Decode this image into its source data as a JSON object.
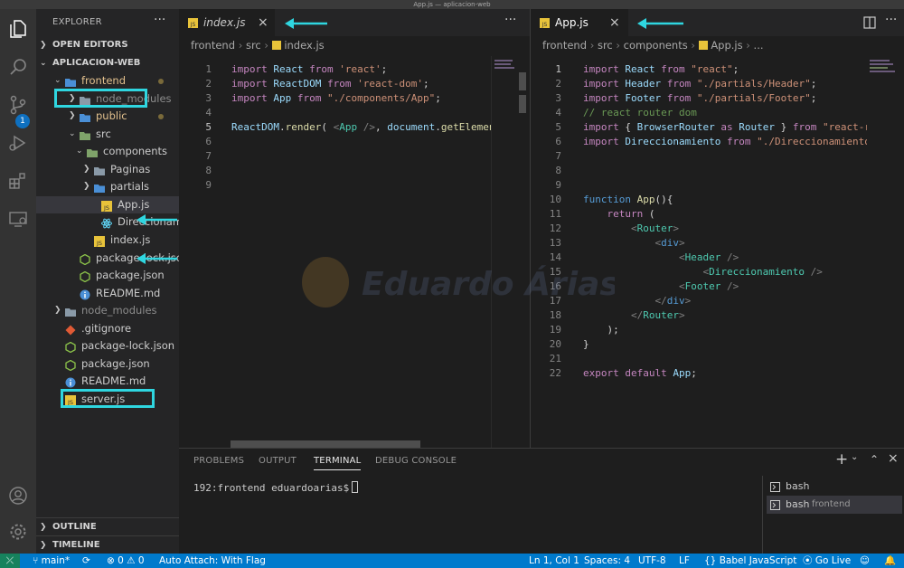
{
  "window": {
    "title": "App.js — aplicacion-web"
  },
  "sidebar": {
    "title": "EXPLORER",
    "more": "···",
    "sections": {
      "open_editors": "OPEN EDITORS",
      "project": "APLICACION-WEB",
      "outline": "OUTLINE",
      "timeline": "TIMELINE"
    },
    "tree": [
      {
        "label": "frontend"
      },
      {
        "label": "node_modules"
      },
      {
        "label": "public"
      },
      {
        "label": "src"
      },
      {
        "label": "components"
      },
      {
        "label": "Paginas"
      },
      {
        "label": "partials"
      },
      {
        "label": "App.js"
      },
      {
        "label": "Direccionamiento.js"
      },
      {
        "label": "index.js"
      },
      {
        "label": "package-lock.json"
      },
      {
        "label": "package.json"
      },
      {
        "label": "README.md"
      },
      {
        "label": "node_modules"
      },
      {
        "label": ".gitignore"
      },
      {
        "label": "package-lock.json"
      },
      {
        "label": "package.json"
      },
      {
        "label": "README.md"
      },
      {
        "label": "server.js"
      }
    ]
  },
  "activity_bar": {
    "badge": "1"
  },
  "left_editor": {
    "tab": {
      "label": "index.js",
      "close": "×"
    },
    "actions": "···",
    "breadcrumb": {
      "a": "frontend",
      "b": "src",
      "c": "index.js"
    },
    "line_numbers": [
      "1",
      "2",
      "3",
      "4",
      "5",
      "6",
      "7",
      "8",
      "9"
    ],
    "lines": [
      [
        [
          "kw2",
          "import"
        ],
        [
          "txt",
          " "
        ],
        [
          "var",
          "React"
        ],
        [
          "txt",
          " "
        ],
        [
          "kw2",
          "from"
        ],
        [
          "txt",
          " "
        ],
        [
          "str",
          "'react'"
        ],
        [
          "txt",
          ";"
        ]
      ],
      [
        [
          "kw2",
          "import"
        ],
        [
          "txt",
          " "
        ],
        [
          "var",
          "ReactDOM"
        ],
        [
          "txt",
          " "
        ],
        [
          "kw2",
          "from"
        ],
        [
          "txt",
          " "
        ],
        [
          "str",
          "'react-dom'"
        ],
        [
          "txt",
          ";"
        ]
      ],
      [
        [
          "kw2",
          "import"
        ],
        [
          "txt",
          " "
        ],
        [
          "var",
          "App"
        ],
        [
          "txt",
          " "
        ],
        [
          "kw2",
          "from"
        ],
        [
          "txt",
          " "
        ],
        [
          "str",
          "\"./components/App\""
        ],
        [
          "txt",
          ";"
        ]
      ],
      [],
      [
        [
          "var",
          "ReactDOM"
        ],
        [
          "txt",
          "."
        ],
        [
          "fn",
          "render"
        ],
        [
          "txt",
          "( "
        ],
        [
          "punc",
          "<"
        ],
        [
          "tag",
          "App"
        ],
        [
          "txt",
          " "
        ],
        [
          "punc",
          "/>"
        ],
        [
          "txt",
          ", "
        ],
        [
          "var",
          "document"
        ],
        [
          "txt",
          "."
        ],
        [
          "fn",
          "getElement"
        ]
      ],
      [],
      [],
      [],
      []
    ]
  },
  "right_editor": {
    "tab": {
      "label": "App.js",
      "close": "×"
    },
    "breadcrumb": {
      "a": "frontend",
      "b": "src",
      "c": "components",
      "d": "App.js",
      "e": "..."
    },
    "line_numbers": [
      "1",
      "2",
      "3",
      "4",
      "5",
      "6",
      "7",
      "8",
      "9",
      "10",
      "11",
      "12",
      "13",
      "14",
      "15",
      "16",
      "17",
      "18",
      "19",
      "20",
      "21",
      "22"
    ],
    "lines": [
      [
        [
          "kw2",
          "import"
        ],
        [
          "txt",
          " "
        ],
        [
          "var",
          "React"
        ],
        [
          "txt",
          " "
        ],
        [
          "kw2",
          "from"
        ],
        [
          "txt",
          " "
        ],
        [
          "str",
          "\"react\""
        ],
        [
          "txt",
          ";"
        ]
      ],
      [
        [
          "kw2",
          "import"
        ],
        [
          "txt",
          " "
        ],
        [
          "var",
          "Header"
        ],
        [
          "txt",
          " "
        ],
        [
          "kw2",
          "from"
        ],
        [
          "txt",
          " "
        ],
        [
          "str",
          "\"./partials/Header\""
        ],
        [
          "txt",
          ";"
        ]
      ],
      [
        [
          "kw2",
          "import"
        ],
        [
          "txt",
          " "
        ],
        [
          "var",
          "Footer"
        ],
        [
          "txt",
          " "
        ],
        [
          "kw2",
          "from"
        ],
        [
          "txt",
          " "
        ],
        [
          "str",
          "\"./partials/Footer\""
        ],
        [
          "txt",
          ";"
        ]
      ],
      [
        [
          "cm",
          "// react router dom"
        ]
      ],
      [
        [
          "kw2",
          "import"
        ],
        [
          "txt",
          " { "
        ],
        [
          "var",
          "BrowserRouter"
        ],
        [
          "txt",
          " "
        ],
        [
          "kw2",
          "as"
        ],
        [
          "txt",
          " "
        ],
        [
          "var",
          "Router"
        ],
        [
          "txt",
          " } "
        ],
        [
          "kw2",
          "from"
        ],
        [
          "txt",
          " "
        ],
        [
          "str",
          "\"react-ro"
        ]
      ],
      [
        [
          "kw2",
          "import"
        ],
        [
          "txt",
          " "
        ],
        [
          "var",
          "Direccionamiento"
        ],
        [
          "txt",
          " "
        ],
        [
          "kw2",
          "from"
        ],
        [
          "txt",
          " "
        ],
        [
          "str",
          "\"./Direccionamiento\""
        ]
      ],
      [],
      [],
      [],
      [
        [
          "kw",
          "function"
        ],
        [
          "txt",
          " "
        ],
        [
          "fn",
          "App"
        ],
        [
          "txt",
          "(){"
        ]
      ],
      [
        [
          "txt",
          "    "
        ],
        [
          "kw2",
          "return"
        ],
        [
          "txt",
          " ("
        ]
      ],
      [
        [
          "txt",
          "        "
        ],
        [
          "punc",
          "<"
        ],
        [
          "tag",
          "Router"
        ],
        [
          "punc",
          ">"
        ]
      ],
      [
        [
          "txt",
          "            "
        ],
        [
          "punc",
          "<"
        ],
        [
          "kw",
          "div"
        ],
        [
          "punc",
          ">"
        ]
      ],
      [
        [
          "txt",
          "                "
        ],
        [
          "punc",
          "<"
        ],
        [
          "tag",
          "Header"
        ],
        [
          "txt",
          " "
        ],
        [
          "punc",
          "/>"
        ]
      ],
      [
        [
          "txt",
          "                    "
        ],
        [
          "punc",
          "<"
        ],
        [
          "tag",
          "Direccionamiento"
        ],
        [
          "txt",
          " "
        ],
        [
          "punc",
          "/>"
        ]
      ],
      [
        [
          "txt",
          "                "
        ],
        [
          "punc",
          "<"
        ],
        [
          "tag",
          "Footer"
        ],
        [
          "txt",
          " "
        ],
        [
          "punc",
          "/>"
        ]
      ],
      [
        [
          "txt",
          "            "
        ],
        [
          "punc",
          "</"
        ],
        [
          "kw",
          "div"
        ],
        [
          "punc",
          ">"
        ]
      ],
      [
        [
          "txt",
          "        "
        ],
        [
          "punc",
          "</"
        ],
        [
          "tag",
          "Router"
        ],
        [
          "punc",
          ">"
        ]
      ],
      [
        [
          "txt",
          "    );"
        ]
      ],
      [
        [
          "txt",
          "}"
        ]
      ],
      [],
      [
        [
          "kw2",
          "export"
        ],
        [
          "txt",
          " "
        ],
        [
          "kw2",
          "default"
        ],
        [
          "txt",
          " "
        ],
        [
          "var",
          "App"
        ],
        [
          "txt",
          ";"
        ]
      ]
    ]
  },
  "panel": {
    "tabs": [
      "PROBLEMS",
      "OUTPUT",
      "TERMINAL",
      "DEBUG CONSOLE"
    ],
    "prompt": "192:frontend eduardoarias$",
    "terminals": [
      {
        "name": "bash",
        "sub": ""
      },
      {
        "name": "bash",
        "sub": "frontend"
      }
    ]
  },
  "statusbar": {
    "branch": "main*",
    "problems": "0",
    "warnings": "0",
    "auto_attach": "Auto Attach: With Flag",
    "position": "Ln 1, Col 1",
    "spaces": "Spaces: 4",
    "encoding": "UTF-8",
    "eol": "LF",
    "language": "Babel JavaScript",
    "golive": "Go Live"
  },
  "colors": {
    "accent": "#007acc",
    "highlight": "#2fd6e0",
    "js": "#e8c33a"
  }
}
